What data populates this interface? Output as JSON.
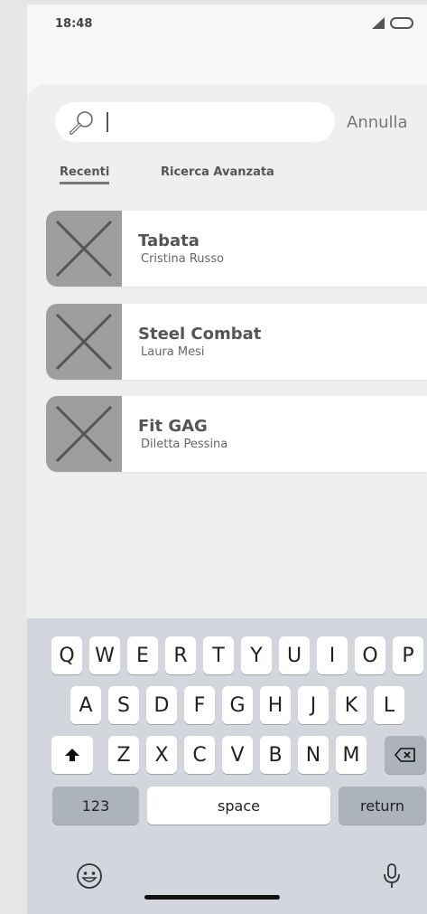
{
  "status_bar": {
    "time": "18:48"
  },
  "search": {
    "placeholder": "",
    "cancel_label": "Annulla"
  },
  "tabs": [
    {
      "label": "Recenti",
      "active": true
    },
    {
      "label": "Ricerca Avanzata",
      "active": false
    }
  ],
  "results": [
    {
      "title": "Tabata",
      "subtitle": "Cristina Russo"
    },
    {
      "title": "Steel Combat",
      "subtitle": "Laura Mesi"
    },
    {
      "title": "Fit GAG",
      "subtitle": "Diletta Pessina"
    }
  ],
  "keyboard": {
    "row1": [
      "Q",
      "W",
      "E",
      "R",
      "T",
      "Y",
      "U",
      "I",
      "O",
      "P"
    ],
    "row2": [
      "A",
      "S",
      "D",
      "F",
      "G",
      "H",
      "J",
      "K",
      "L"
    ],
    "row3": [
      "Z",
      "X",
      "C",
      "V",
      "B",
      "N",
      "M"
    ],
    "numbers_label": "123",
    "space_label": "space",
    "return_label": "return",
    "shift_icon": "shift-icon",
    "delete_icon": "delete-icon",
    "emoji_icon": "emoji-icon",
    "mic_icon": "microphone-icon"
  }
}
